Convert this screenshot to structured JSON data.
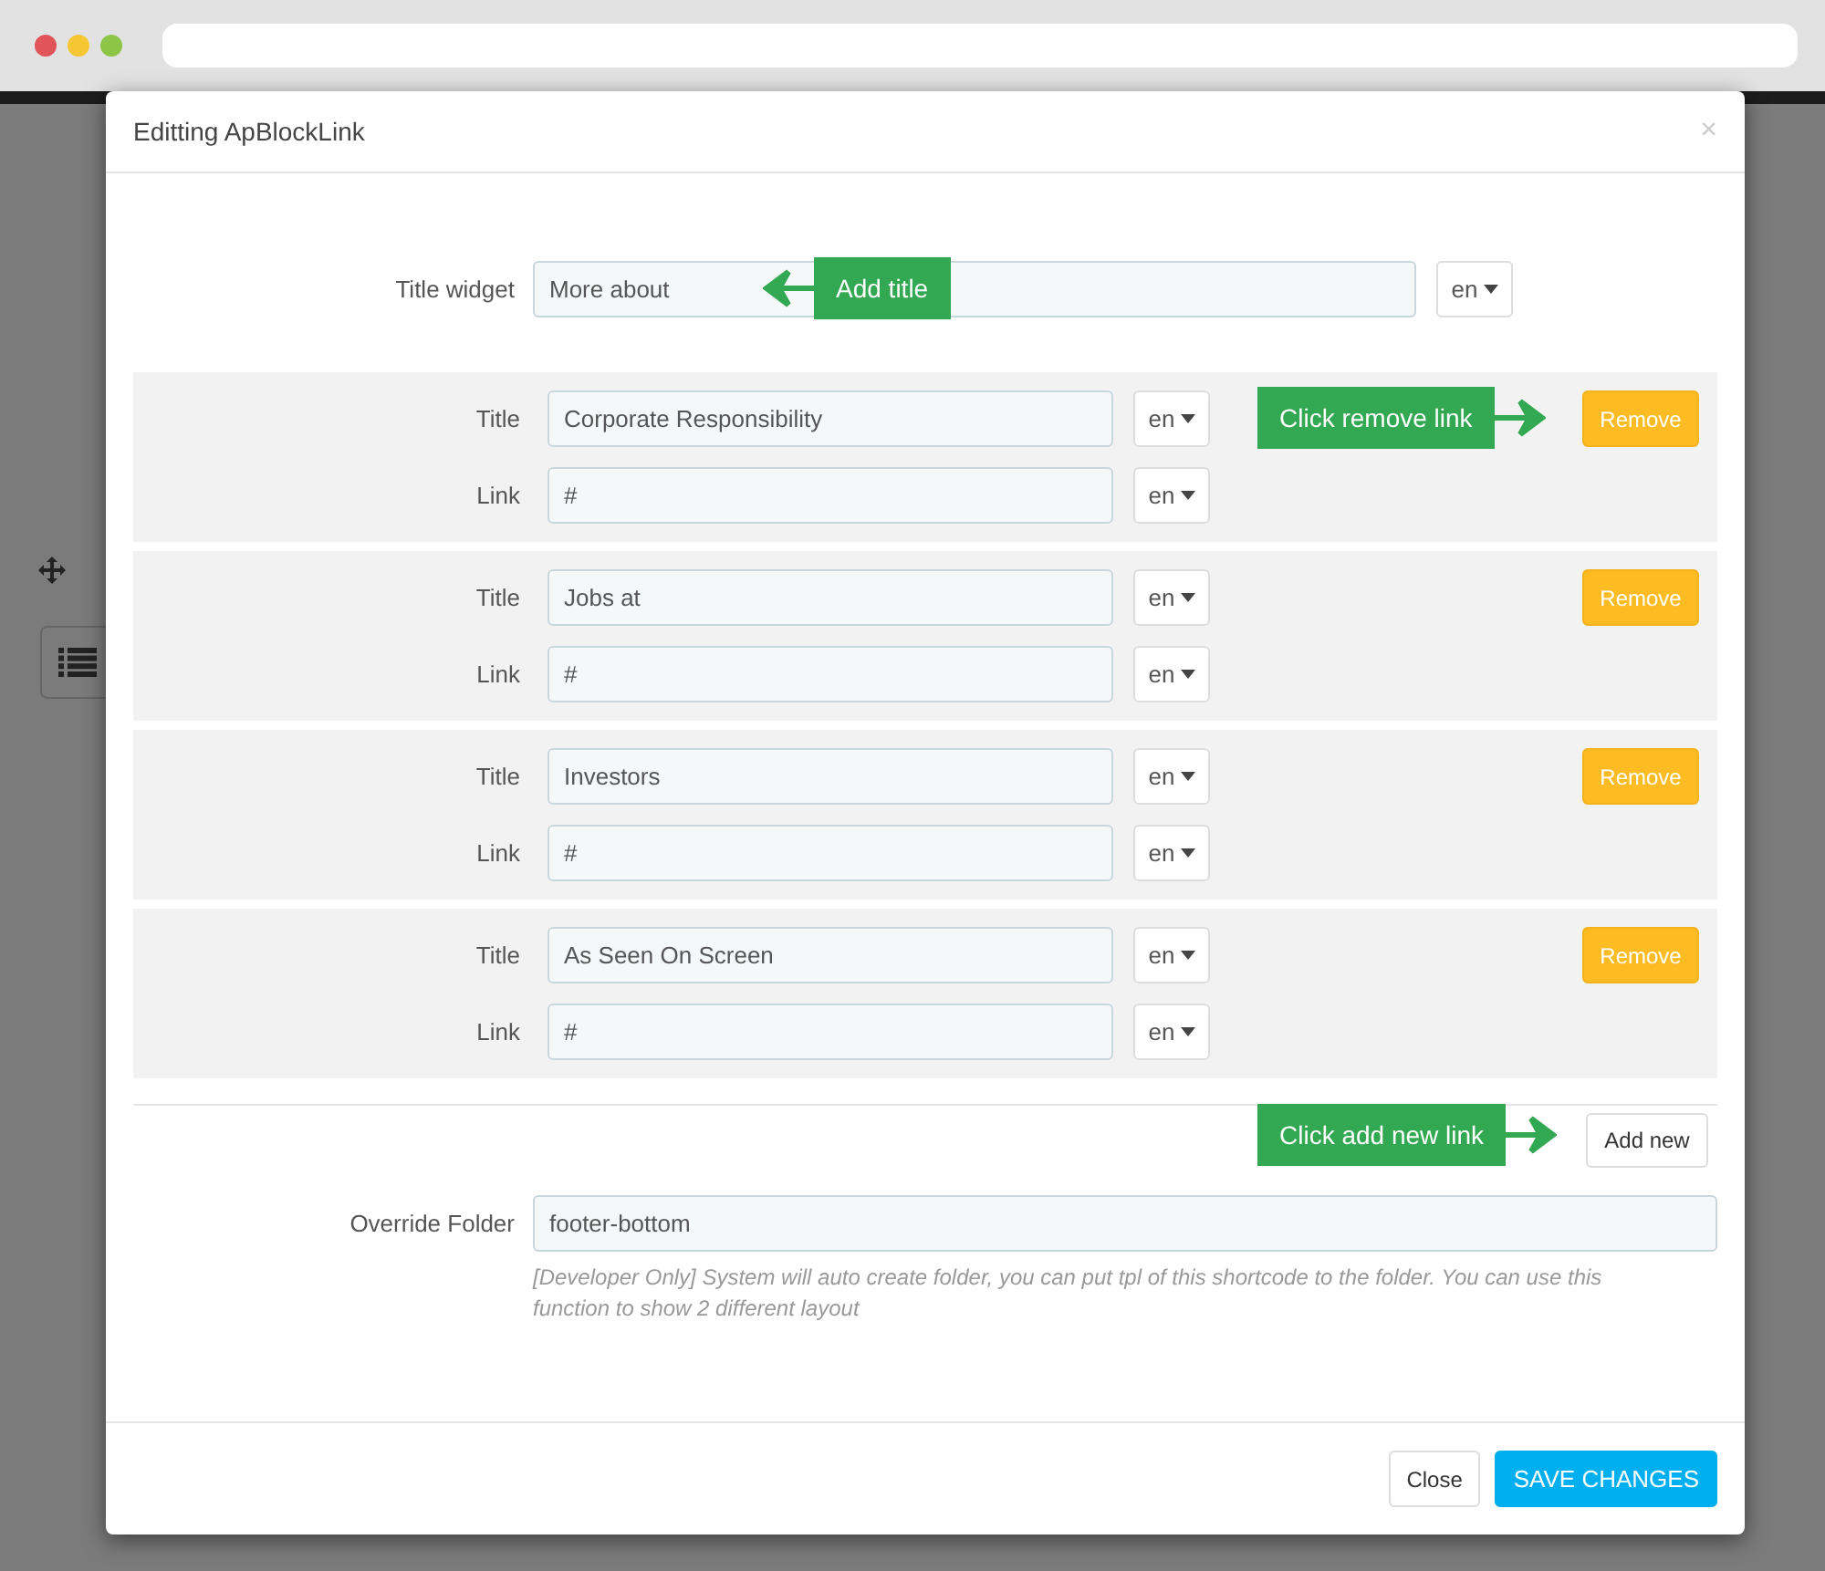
{
  "modal": {
    "title": "Editting ApBlockLink",
    "close": "×"
  },
  "title_widget": {
    "label": "Title widget",
    "value": "More about",
    "lang": "en",
    "callout": "Add title"
  },
  "links": [
    {
      "title_label": "Title",
      "title": "Corporate Responsibility",
      "title_lang": "en",
      "link_label": "Link",
      "link": "#",
      "link_lang": "en",
      "remove": "Remove",
      "callout": "Click remove link"
    },
    {
      "title_label": "Title",
      "title": "Jobs at",
      "title_lang": "en",
      "link_label": "Link",
      "link": "#",
      "link_lang": "en",
      "remove": "Remove"
    },
    {
      "title_label": "Title",
      "title": "Investors",
      "title_lang": "en",
      "link_label": "Link",
      "link": "#",
      "link_lang": "en",
      "remove": "Remove"
    },
    {
      "title_label": "Title",
      "title": "As Seen On Screen",
      "title_lang": "en",
      "link_label": "Link",
      "link": "#",
      "link_lang": "en",
      "remove": "Remove"
    }
  ],
  "add_new": {
    "label": "Add new",
    "callout": "Click add new link"
  },
  "override": {
    "label": "Override Folder",
    "value": "footer-bottom",
    "help": "[Developer Only] System will auto create folder, you can put tpl of this shortcode to the folder. You can use this function to show 2 different layout"
  },
  "footer": {
    "buttons": [
      {
        "label": "Close",
        "kind": "default"
      },
      {
        "label": "SAVE CHANGES",
        "kind": "primary"
      }
    ]
  }
}
